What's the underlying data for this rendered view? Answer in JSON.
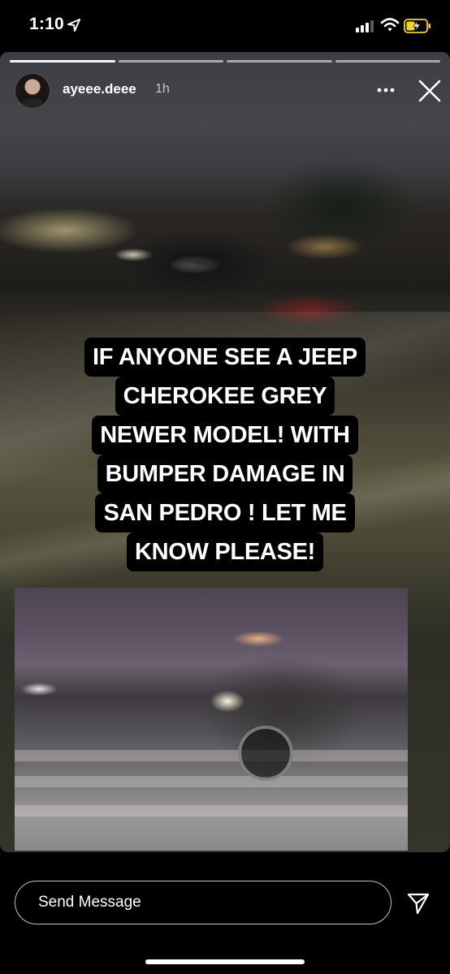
{
  "status_bar": {
    "time": "1:10",
    "icons": [
      "location-arrow-icon",
      "cellular-signal-icon",
      "wifi-icon",
      "battery-charging-icon"
    ],
    "battery_color": "#f2d230"
  },
  "story": {
    "username": "ayeee.deee",
    "time_ago": "1h",
    "segments_total": 4,
    "caption_lines": [
      "IF ANYONE SEE A JEEP",
      "CHEROKEE GREY",
      "NEWER MODEL! WITH",
      "BUMPER DAMAGE IN",
      "SAN PEDRO ! LET ME",
      "KNOW PLEASE!"
    ],
    "icons": [
      "more-options-icon",
      "close-icon"
    ]
  },
  "bottom_bar": {
    "message_placeholder": "Send Message",
    "icons": [
      "send-icon"
    ]
  },
  "colors": {
    "background": "#000000",
    "text": "#ffffff",
    "caption_highlight": "#000000"
  }
}
